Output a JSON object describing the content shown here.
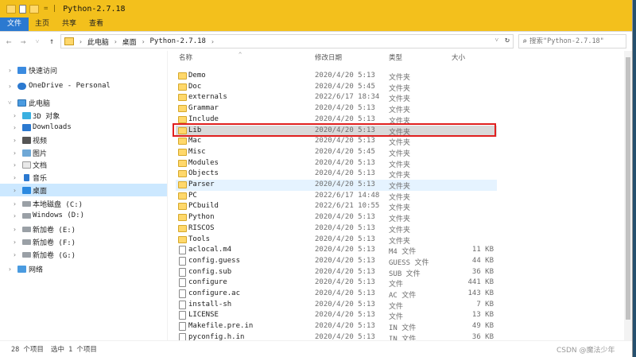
{
  "window": {
    "title": "Python-2.7.18",
    "title_separator": "= |"
  },
  "ribbon": {
    "tabs": [
      "文件",
      "主页",
      "共享",
      "查看"
    ]
  },
  "nav": {
    "back_icon": "←",
    "forward_icon": "→",
    "recent_icon": "˅",
    "up_icon": "↑",
    "breadcrumb": [
      "此电脑",
      "桌面",
      "Python-2.7.18"
    ],
    "breadcrumb_separator": "›",
    "dropdown_icon": "˅",
    "refresh_icon": "↻",
    "search_icon": "⌕",
    "search_placeholder": "搜索\"Python-2.7.18\""
  },
  "sidebar": {
    "items": [
      {
        "label": "快速访问",
        "icon": "star-icon",
        "expand": "›",
        "level": 0
      },
      {
        "label": "OneDrive - Personal",
        "icon": "cloud-icon",
        "expand": "›",
        "level": 0
      },
      {
        "label": "此电脑",
        "icon": "computer-icon",
        "expand": "˅",
        "level": 0
      },
      {
        "label": "3D 对象",
        "icon": "cube-icon",
        "expand": "›",
        "level": 1
      },
      {
        "label": "Downloads",
        "icon": "download-icon",
        "expand": "›",
        "level": 1
      },
      {
        "label": "视频",
        "icon": "video-icon",
        "expand": "›",
        "level": 1
      },
      {
        "label": "图片",
        "icon": "picture-icon",
        "expand": "›",
        "level": 1
      },
      {
        "label": "文档",
        "icon": "document-icon",
        "expand": "›",
        "level": 1
      },
      {
        "label": "音乐",
        "icon": "music-icon",
        "expand": "›",
        "level": 1
      },
      {
        "label": "桌面",
        "icon": "desktop-icon",
        "expand": "›",
        "level": 1,
        "selected": true
      },
      {
        "label": "本地磁盘 (C:)",
        "icon": "disk-icon",
        "expand": "›",
        "level": 1
      },
      {
        "label": "Windows (D:)",
        "icon": "disk-icon",
        "expand": "›",
        "level": 1
      },
      {
        "label": "新加卷 (E:)",
        "icon": "disk-icon",
        "expand": "›",
        "level": 1
      },
      {
        "label": "新加卷 (F:)",
        "icon": "disk-icon",
        "expand": "›",
        "level": 1
      },
      {
        "label": "新加卷 (G:)",
        "icon": "disk-icon",
        "expand": "›",
        "level": 1
      },
      {
        "label": "网络",
        "icon": "network-icon",
        "expand": "›",
        "level": 0
      }
    ]
  },
  "columns": {
    "name": "名称",
    "date": "修改日期",
    "type": "类型",
    "size": "大小",
    "sort_icon": "^"
  },
  "files": [
    {
      "name": "Demo",
      "date": "2020/4/20 5:13",
      "type": "文件夹",
      "size": "",
      "kind": "folder"
    },
    {
      "name": "Doc",
      "date": "2020/4/20 5:45",
      "type": "文件夹",
      "size": "",
      "kind": "folder"
    },
    {
      "name": "externals",
      "date": "2022/6/17 18:34",
      "type": "文件夹",
      "size": "",
      "kind": "folder"
    },
    {
      "name": "Grammar",
      "date": "2020/4/20 5:13",
      "type": "文件夹",
      "size": "",
      "kind": "folder"
    },
    {
      "name": "Include",
      "date": "2020/4/20 5:13",
      "type": "文件夹",
      "size": "",
      "kind": "folder"
    },
    {
      "name": "Lib",
      "date": "2020/4/20 5:13",
      "type": "文件夹",
      "size": "",
      "kind": "folder",
      "state": "selected"
    },
    {
      "name": "Mac",
      "date": "2020/4/20 5:13",
      "type": "文件夹",
      "size": "",
      "kind": "folder"
    },
    {
      "name": "Misc",
      "date": "2020/4/20 5:45",
      "type": "文件夹",
      "size": "",
      "kind": "folder"
    },
    {
      "name": "Modules",
      "date": "2020/4/20 5:13",
      "type": "文件夹",
      "size": "",
      "kind": "folder"
    },
    {
      "name": "Objects",
      "date": "2020/4/20 5:13",
      "type": "文件夹",
      "size": "",
      "kind": "folder"
    },
    {
      "name": "Parser",
      "date": "2020/4/20 5:13",
      "type": "文件夹",
      "size": "",
      "kind": "folder",
      "state": "hover"
    },
    {
      "name": "PC",
      "date": "2022/6/17 14:48",
      "type": "文件夹",
      "size": "",
      "kind": "folder"
    },
    {
      "name": "PCbuild",
      "date": "2022/6/21 10:55",
      "type": "文件夹",
      "size": "",
      "kind": "folder"
    },
    {
      "name": "Python",
      "date": "2020/4/20 5:13",
      "type": "文件夹",
      "size": "",
      "kind": "folder"
    },
    {
      "name": "RISCOS",
      "date": "2020/4/20 5:13",
      "type": "文件夹",
      "size": "",
      "kind": "folder"
    },
    {
      "name": "Tools",
      "date": "2020/4/20 5:13",
      "type": "文件夹",
      "size": "",
      "kind": "folder"
    },
    {
      "name": "aclocal.m4",
      "date": "2020/4/20 5:13",
      "type": "M4 文件",
      "size": "11 KB",
      "kind": "file"
    },
    {
      "name": "config.guess",
      "date": "2020/4/20 5:13",
      "type": "GUESS 文件",
      "size": "44 KB",
      "kind": "file"
    },
    {
      "name": "config.sub",
      "date": "2020/4/20 5:13",
      "type": "SUB 文件",
      "size": "36 KB",
      "kind": "file"
    },
    {
      "name": "configure",
      "date": "2020/4/20 5:13",
      "type": "文件",
      "size": "441 KB",
      "kind": "file"
    },
    {
      "name": "configure.ac",
      "date": "2020/4/20 5:13",
      "type": "AC 文件",
      "size": "143 KB",
      "kind": "file"
    },
    {
      "name": "install-sh",
      "date": "2020/4/20 5:13",
      "type": "文件",
      "size": "7 KB",
      "kind": "file"
    },
    {
      "name": "LICENSE",
      "date": "2020/4/20 5:13",
      "type": "文件",
      "size": "13 KB",
      "kind": "file"
    },
    {
      "name": "Makefile.pre.in",
      "date": "2020/4/20 5:13",
      "type": "IN 文件",
      "size": "49 KB",
      "kind": "file"
    },
    {
      "name": "pyconfig.h.in",
      "date": "2020/4/20 5:13",
      "type": "IN 文件",
      "size": "36 KB",
      "kind": "file"
    }
  ],
  "status": {
    "item_count": "28 个项目",
    "selection": "选中 1 个项目"
  },
  "watermark": "CSDN @魔法少年",
  "colors": {
    "titlebar": "#f3c01c",
    "file_tab": "#2b79d0",
    "selection_box": "#e0201f",
    "hover_row": "#e5f3ff",
    "selected_row": "#d9d9d9"
  }
}
